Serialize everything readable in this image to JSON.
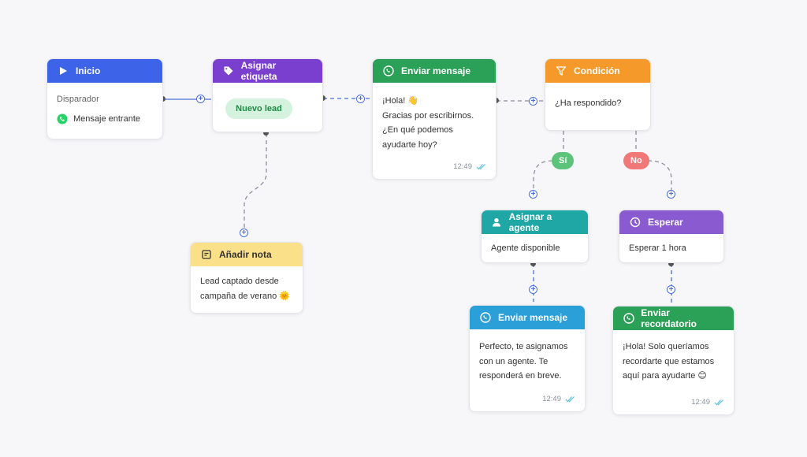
{
  "nodes": {
    "start": {
      "title": "Inicio",
      "label": "Disparador",
      "value": "Mensaje entrante",
      "color": "#3d63e8"
    },
    "tag": {
      "title": "Asignar etiqueta",
      "tag": "Nuevo lead",
      "color": "#7b3fcf"
    },
    "send1": {
      "title": "Enviar mensaje",
      "lines": [
        "¡Hola! 👋",
        "Gracias por escribirnos.",
        "¿En qué podemos",
        "ayudarte hoy?"
      ],
      "time": "12:49",
      "color": "#2aa157"
    },
    "condition": {
      "title": "Condición",
      "question": "¿Ha respondido?",
      "color": "#f59a2a"
    },
    "note": {
      "title": "Añadir nota",
      "lines": [
        "Lead captado desde",
        "campaña de verano 🌞"
      ],
      "color": "#fbe08a"
    },
    "assign": {
      "title": "Asignar a agente",
      "text": "Agente disponible",
      "color": "#1fa7a5"
    },
    "wait": {
      "title": "Esperar",
      "text": "Esperar 1 hora",
      "color": "#8a5ad1"
    },
    "send2": {
      "title": "Enviar mensaje",
      "lines": [
        "Perfecto, te asignamos",
        "con un agente. Te",
        "responderá en breve."
      ],
      "time": "12:49",
      "color": "#2a9fd8"
    },
    "reminder": {
      "title": "Enviar recordatorio",
      "lines": [
        "¡Hola! Solo queríamos",
        "recordarte que estamos",
        "aquí para ayudarte 😊"
      ],
      "time": "12:49",
      "color": "#2aa157"
    }
  },
  "branches": {
    "yes": "Sí",
    "no": "No"
  },
  "colors": {
    "connector": "#4a6fd8",
    "yes": "#5cc47a",
    "no": "#f07878",
    "whatsapp": "#25d366",
    "read_check": "#5bbfd8"
  },
  "icons": [
    "play-icon",
    "tag-icon",
    "whatsapp-icon",
    "filter-icon",
    "note-icon",
    "user-icon",
    "clock-icon",
    "double-check-icon"
  ]
}
